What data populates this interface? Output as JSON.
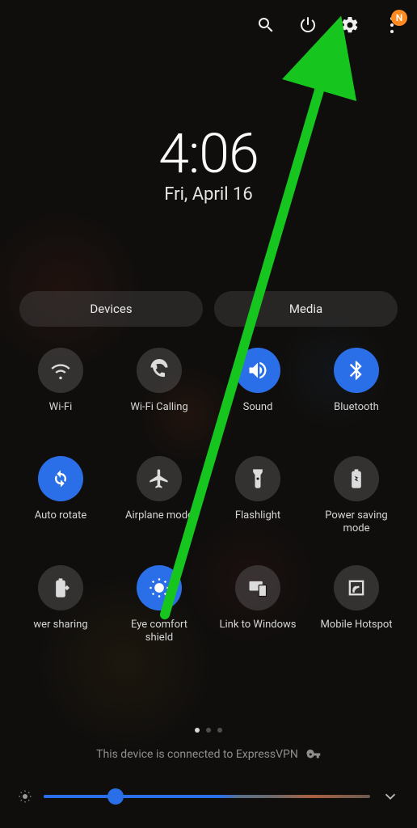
{
  "header": {
    "badge_letter": "N"
  },
  "clock": {
    "time": "4:06",
    "date": "Fri, April 16"
  },
  "pills": {
    "devices": "Devices",
    "media": "Media"
  },
  "toggles": [
    {
      "id": "wifi",
      "label": "Wi-Fi",
      "active": false,
      "icon": "wifi-icon"
    },
    {
      "id": "wifi-calling",
      "label": "Wi-Fi Calling",
      "active": false,
      "icon": "wifi-calling-icon"
    },
    {
      "id": "sound",
      "label": "Sound",
      "active": true,
      "icon": "sound-icon"
    },
    {
      "id": "bluetooth",
      "label": "Bluetooth",
      "active": true,
      "icon": "bluetooth-icon"
    },
    {
      "id": "auto-rotate",
      "label": "Auto rotate",
      "active": true,
      "icon": "rotate-icon"
    },
    {
      "id": "airplane",
      "label": "Airplane mode",
      "active": false,
      "icon": "airplane-icon"
    },
    {
      "id": "flashlight",
      "label": "Flashlight",
      "active": false,
      "icon": "flashlight-icon"
    },
    {
      "id": "power-saving",
      "label": "Power saving mode",
      "active": false,
      "icon": "battery-icon"
    },
    {
      "id": "power-sharing",
      "label": "wer sharing",
      "active": false,
      "icon": "power-share-icon"
    },
    {
      "id": "eye-comfort",
      "label": "Eye comfort shield",
      "active": true,
      "icon": "eye-comfort-icon"
    },
    {
      "id": "link-windows",
      "label": "Link to Windows",
      "active": false,
      "icon": "link-windows-icon"
    },
    {
      "id": "hotspot",
      "label": "Mobile Hotspot",
      "active": false,
      "icon": "hotspot-icon"
    }
  ],
  "pagination": {
    "count": 3,
    "active": 0
  },
  "vpn": {
    "text": "This device is connected to ExpressVPN"
  },
  "brightness": {
    "percent": 22
  },
  "colors": {
    "accent": "#2a6fe8",
    "badge": "#ff8a1f",
    "arrow": "#17c51f"
  }
}
